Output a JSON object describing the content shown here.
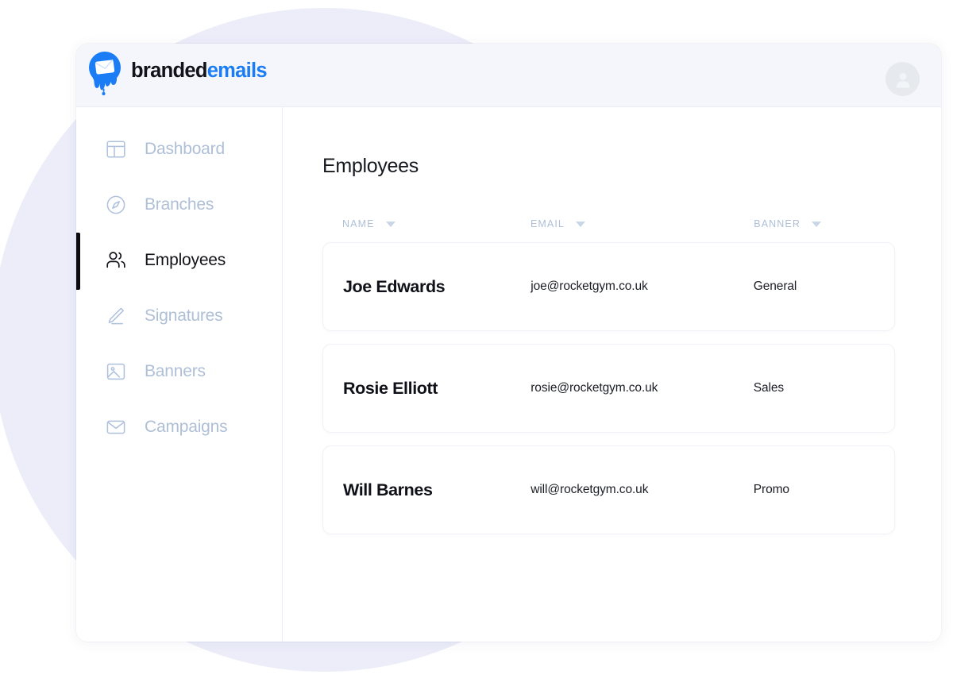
{
  "brand": {
    "name_part1": "branded",
    "name_part2": "emails",
    "logo_icon": "envelope-drip-logo",
    "color_dark": "#12131a",
    "color_blue": "#1a7df5"
  },
  "topbar": {
    "avatar_icon": "user-avatar-icon"
  },
  "sidebar": {
    "items": [
      {
        "label": "Dashboard",
        "icon": "layout-dashboard-icon",
        "active": false
      },
      {
        "label": "Branches",
        "icon": "compass-icon",
        "active": false
      },
      {
        "label": "Employees",
        "icon": "users-icon",
        "active": true
      },
      {
        "label": "Signatures",
        "icon": "pencil-icon",
        "active": false
      },
      {
        "label": "Banners",
        "icon": "image-icon",
        "active": false
      },
      {
        "label": "Campaigns",
        "icon": "envelope-icon",
        "active": false
      }
    ],
    "active_indicator_color": "#0a0a10",
    "inactive_color": "#aebfd6"
  },
  "main": {
    "page_title": "Employees",
    "table": {
      "columns": [
        {
          "label": "NAME",
          "sort_icon": "chevron-down-icon"
        },
        {
          "label": "EMAIL",
          "sort_icon": "chevron-down-icon"
        },
        {
          "label": "BANNER",
          "sort_icon": "chevron-down-icon"
        }
      ],
      "rows": [
        {
          "name": "Joe Edwards",
          "email": "joe@rocketgym.co.uk",
          "banner": "General"
        },
        {
          "name": "Rosie Elliott",
          "email": "rosie@rocketgym.co.uk",
          "banner": "Sales"
        },
        {
          "name": "Will Barnes",
          "email": "will@rocketgym.co.uk",
          "banner": "Promo"
        }
      ]
    }
  },
  "decor": {
    "blob_color": "#ecedf9"
  }
}
